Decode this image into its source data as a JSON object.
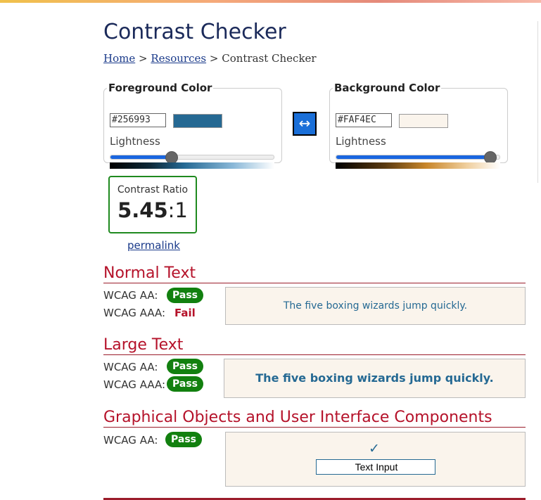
{
  "title": "Contrast Checker",
  "breadcrumb": {
    "home": "Home",
    "sep1": ">",
    "resources": "Resources",
    "sep2": ">",
    "current": "Contrast Checker"
  },
  "foreground": {
    "legend": "Foreground Color",
    "hex": "#256993",
    "color": "#256993",
    "lightness_label": "Lightness",
    "lightness": 0.37
  },
  "background": {
    "legend": "Background Color",
    "hex": "#FAF4EC",
    "color": "#FAF4EC",
    "lightness_label": "Lightness",
    "lightness": 0.94
  },
  "swap_icon": "↔",
  "ratio": {
    "label": "Contrast Ratio",
    "value": "5.45",
    "suffix": ":1"
  },
  "permalink": "permalink",
  "normal": {
    "heading": "Normal Text",
    "aa_label": "WCAG AA:",
    "aa": "Pass",
    "aaa_label": "WCAG AAA:",
    "aaa": "Fail",
    "sample": "The five boxing wizards jump quickly."
  },
  "large": {
    "heading": "Large Text",
    "aa_label": "WCAG AA:",
    "aa": "Pass",
    "aaa_label": "WCAG AAA:",
    "aaa": "Pass",
    "sample": "The five boxing wizards jump quickly."
  },
  "graphical": {
    "heading": "Graphical Objects and User Interface Components",
    "aa_label": "WCAG AA:",
    "aa": "Pass",
    "check_icon": "✓",
    "input_value": "Text Input"
  },
  "colors": {
    "pass": "#12800f",
    "fail": "#b5122a",
    "heading": "#b5122a",
    "link": "#1a3a8a",
    "slider": "#1a66e0"
  }
}
